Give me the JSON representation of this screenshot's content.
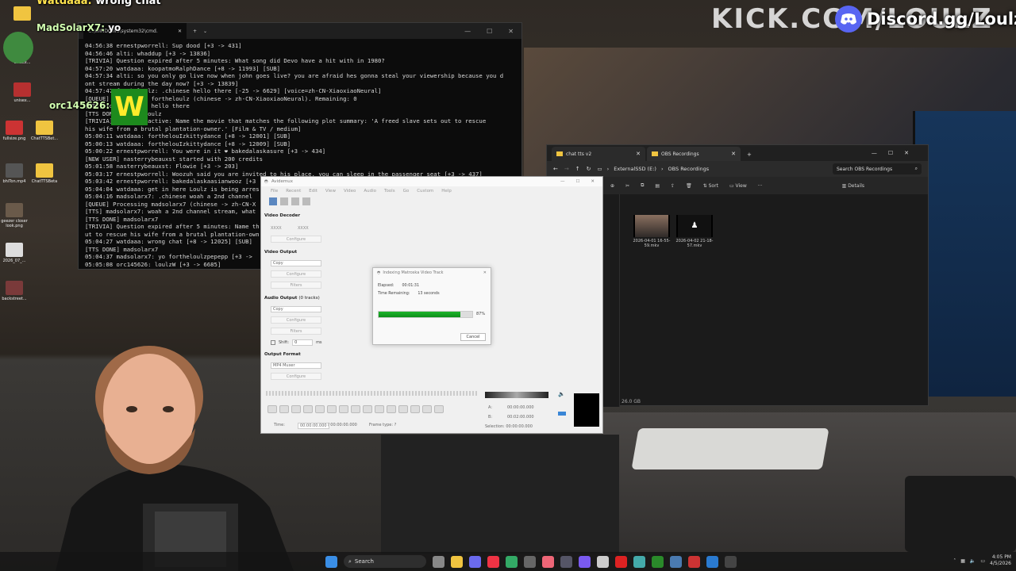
{
  "overlay": {
    "stream_url": "KICK.COM/LOULZ",
    "discord_text": "Discord.gg/Loulz",
    "chat": [
      {
        "user": "Watdaaa:",
        "text": "wrong chat"
      },
      {
        "user": "MadSolarX7:",
        "text": "yo"
      },
      {
        "user": "orc145626:",
        "text": ""
      }
    ],
    "emote": "W"
  },
  "desktop_icons": [
    {
      "label": "",
      "icon": "folder-icon"
    },
    {
      "label": "unisex...",
      "icon": "app-icon"
    },
    {
      "label": "unisex...",
      "icon": "app-icon"
    },
    {
      "label": "fullsize.png",
      "icon": "image-icon"
    },
    {
      "label": "ChatTTSBet...",
      "icon": "folder-icon"
    },
    {
      "label": "bhiTon.mp4",
      "icon": "video-icon"
    },
    {
      "label": "ChatTTSBeta",
      "icon": "folder-icon"
    },
    {
      "label": "geezer closer look.png",
      "icon": "image-icon"
    },
    {
      "label": "2026_07_...",
      "icon": "image-icon"
    },
    {
      "label": "backstreet...",
      "icon": "image-icon"
    }
  ],
  "cmd": {
    "tab_title": "C:\\WINDOWS\\system32\\cmd.",
    "lines": [
      "04:56:38 ernestpworrell: Sup dood [+3 -> 431]",
      "04:56:46 alti: whaddup [+3 -> 13836]",
      "[TRIVIA] Question expired after 5 minutes: What song did Devo have a hit with in 1980?",
      "04:57:20 watdaaa: koopatmoRalphDance [+8 -> 11993] [SUB]",
      "04:57:34 alti: so you only go live now when john goes live? you are afraid hes gonna steal your viewership because you d",
      "ont stream during the day now? [+3 -> 13839]",
      "04:57:47 fortheloulz: .chinese hello there [-25 -> 6629] [voice=zh-CN-XiaoxiaoNeural]",
      "[QUEUE] Processing fortheloulz (chinese -> zh-CN-XiaoxiaoNeural). Remaining: 0",
      "[TTS] fortheloulz: hello there",
      "[TTS DONE] fortheloulz",
      "[TRIVIA] Question active: Name the movie that matches the following plot summary: 'A freed slave sets out to rescue",
      "his wife from a brutal plantation-owner.' [Film & TV / medium]",
      "05:00:11 watdaaa: forthelouIzkittydance [+8 -> 12001] [SUB]",
      "05:00:13 watdaaa: forthelouIzkittydance [+8 -> 12009] [SUB]",
      "05:00:22 ernestpworrell: You were in it ❤ bakedalaskasure [+3 -> 434]",
      "[NEW USER] nasterrybeauxst started with 200 credits",
      "05:01:58 nasterrybeauxst: Flowie [+3 -> 203]",
      "05:03:17 ernestpworrell: Woozuh said you are invited to his place, you can sleep in the passenger seat [+3 -> 437]",
      "05:03:42 ernestpworrell: bakedalaskaasianwooz [+3",
      "05:04:04 watdaaa: get in here Loulz is being arres",
      "05:04:16 madsolarx7: .chinese woah a 2nd channel",
      "[QUEUE] Processing madsolarx7 (chinese -> zh-CN-X",
      "[TTS] madsolarx7: woah a 2nd channel stream, what",
      "[TTS DONE] madsolarx7",
      "[TRIVIA] Question expired after 5 minutes: Name th",
      "ut to rescue his wife from a brutal plantation-own",
      "05:04:27 watdaaa: wrong chat [+8 -> 12025] [SUB]",
      "[TTS DONE] madsolarx7",
      "05:04:37 madsolarx7: yo fortheloulzpepepp [+3 ->",
      "05:05:08 orc145626: loulzW [+3 -> 6685]"
    ]
  },
  "explorer": {
    "tabs": [
      {
        "label": "chat tts v2"
      },
      {
        "label": "OBS Recordings"
      }
    ],
    "breadcrumb": [
      "ExternalSSD (E:)",
      "OBS Recordings"
    ],
    "search_placeholder": "Search OBS Recordings",
    "toolbar": {
      "sort": "Sort",
      "view": "View",
      "more": "···",
      "details": "Details"
    },
    "files": [
      {
        "name": "2026-04-01 16-55-59.mkv"
      },
      {
        "name": "2026-04-02 21-18-57.mkv"
      }
    ],
    "status": "26.0 GB"
  },
  "avidemux": {
    "title": "Avidemux",
    "menu": [
      "File",
      "Recent",
      "Edit",
      "View",
      "Video",
      "Audio",
      "Tools",
      "Go",
      "Custom",
      "Help"
    ],
    "video_decoder": {
      "heading": "Video Decoder",
      "v1": "XXXX",
      "v2": "XXXX",
      "configure": "Configure"
    },
    "video_output": {
      "heading": "Video Output",
      "value": "Copy",
      "configure": "Configure",
      "filters": "Filters"
    },
    "audio_output": {
      "heading": "Audio Output",
      "tracks": "(0 tracks)",
      "value": "Copy",
      "configure": "Configure",
      "filters": "Filters",
      "shift_label": "Shift:",
      "shift_value": "0",
      "shift_unit": "ms"
    },
    "output_format": {
      "heading": "Output Format",
      "value": "MP4 Muxer",
      "configure": "Configure"
    },
    "time": {
      "label": "Time:",
      "current": "00:00:00.000",
      "total": "/ 00:00:00.000",
      "frame_type": "Frame type: ?"
    },
    "markers": {
      "a_label": "A:",
      "a": "00:00:00.000",
      "b_label": "B:",
      "b": "00:02:00.000",
      "selection": "Selection: 00:00:00.000"
    },
    "dialog": {
      "title": "Indexing Matroska Video Track",
      "elapsed_label": "Elapsed:",
      "elapsed": "00:01:31",
      "remaining_label": "Time Remaining:",
      "remaining": "13 seconds",
      "progress": 0.87,
      "progress_text": "87%",
      "cancel": "Cancel"
    }
  },
  "taskbar": {
    "search": "Search",
    "time": "4:05 PM",
    "date": "4/5/2026"
  }
}
